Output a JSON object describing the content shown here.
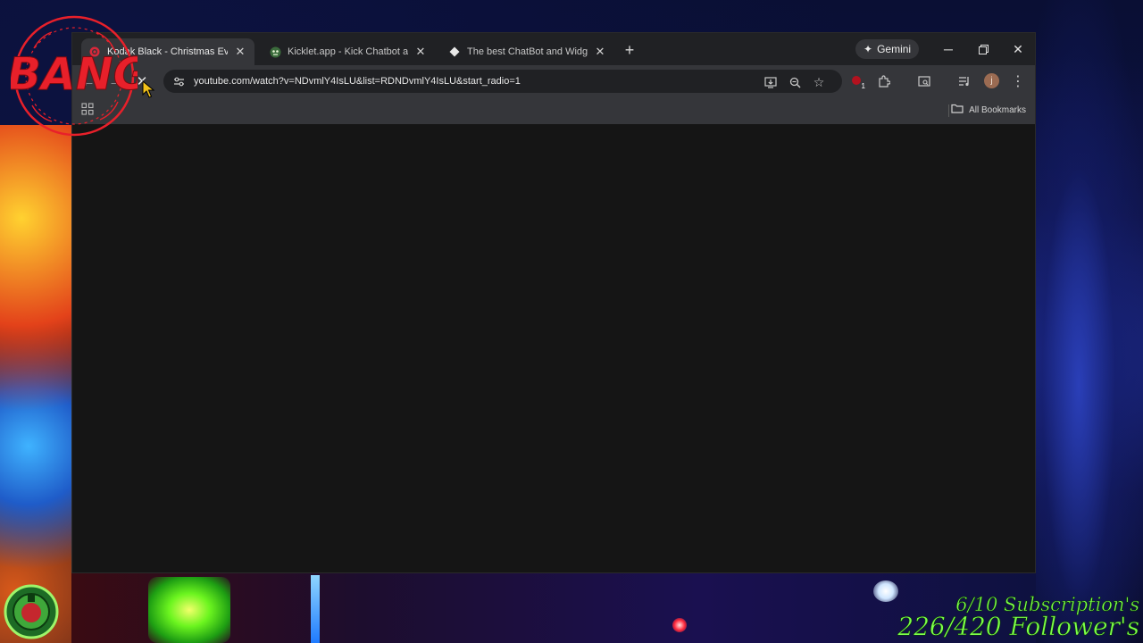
{
  "browser": {
    "tabs": [
      {
        "title": "Kodak Black - Christmas Eve [O",
        "favicon": "youtube-icon",
        "active": true
      },
      {
        "title": "Kicklet.app - Kick Chatbot and (",
        "favicon": "kicklet-icon",
        "active": false
      },
      {
        "title": "The best ChatBot and Widgets",
        "favicon": "diamond-icon",
        "active": false
      }
    ],
    "gemini_label": "Gemini",
    "address_bar": {
      "url": "youtube.com/watch?v=NDvmlY4IsLU&list=RDNDvmlY4IsLU&start_radio=1"
    },
    "extension_badge": "1",
    "profile_initial": "j",
    "bookmarks_bar": {
      "all_bookmarks_label": "All Bookmarks"
    }
  },
  "overlay": {
    "stamp_text": "BANG",
    "subs_line1": "6/10 Subscription's",
    "subs_line2": "226/420 Follower's",
    "accent_green": "#7dff4a",
    "stamp_red": "#e8202a"
  }
}
